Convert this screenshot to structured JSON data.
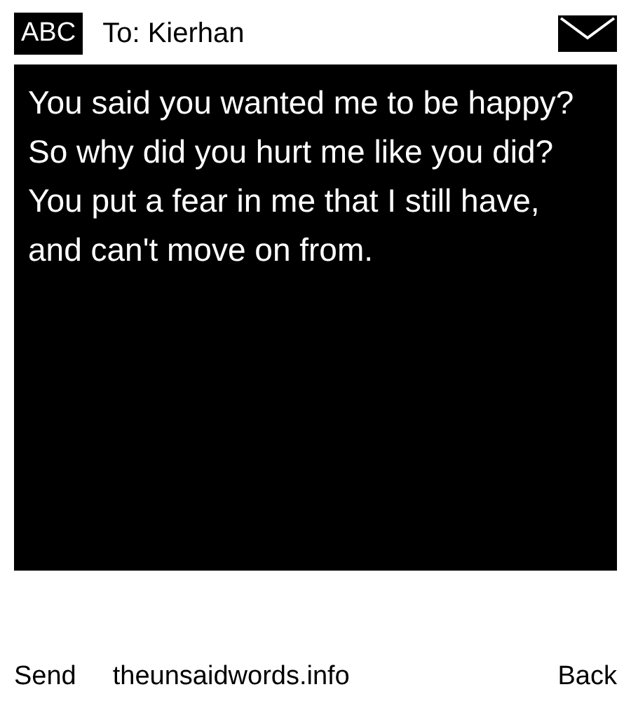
{
  "header": {
    "mode_badge": "ABC",
    "recipient": "To: Kierhan"
  },
  "message": {
    "text": "You said you wanted me to be happy? So why did you hurt me like you did? You put a fear in me that I still have, and can't move on from."
  },
  "softkeys": {
    "left": "Send",
    "center": "theunsaidwords.info",
    "right": "Back"
  }
}
